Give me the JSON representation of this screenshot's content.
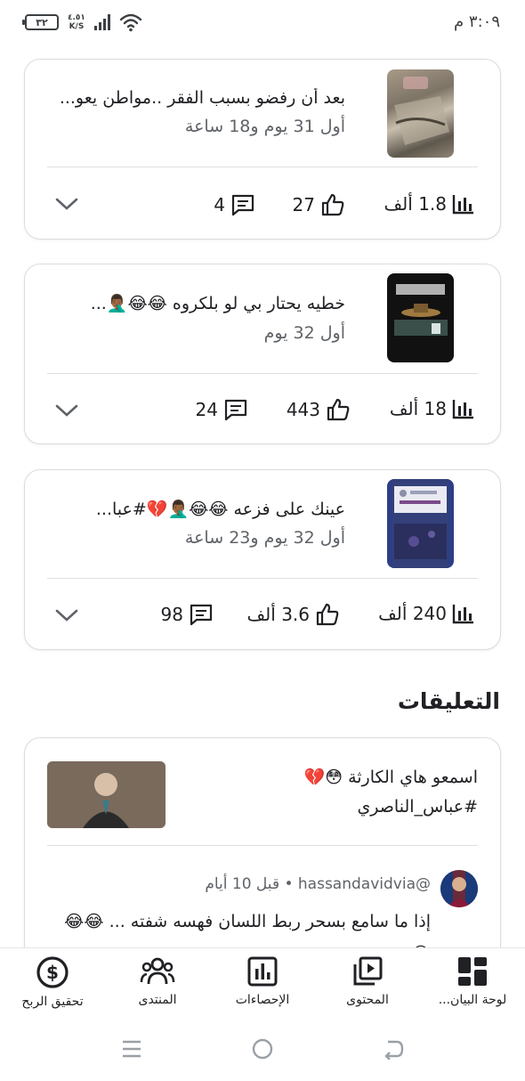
{
  "status_bar": {
    "time": "٣:٠٩ م",
    "battery": "٣٢",
    "net_speed_value": "٤.٥١",
    "net_speed_unit": "K/S"
  },
  "posts": [
    {
      "title": "بعد أن رفضو بسبب الفقر ..مواطن يعو...",
      "time": "أول 31 يوم و18 ساعة",
      "views": "1.8 ألف",
      "likes": "27",
      "comments": "4"
    },
    {
      "title": "خطيه يحتار بي لو بلكروه 😂😂🤦🏾‍♂️...",
      "time": "أول 32 يوم",
      "views": "18 ألف",
      "likes": "443",
      "comments": "24"
    },
    {
      "title": "عينك على فزعه 😂😂🤦🏾‍♂️💔#عبا...",
      "time": "أول 32 يوم و23 ساعة",
      "views": "240 ألف",
      "likes": "3.6 ألف",
      "comments": "98"
    }
  ],
  "comments_section": {
    "title": "التعليقات",
    "post_text_line1": "اسمعو هاي الكارثة 😳💔",
    "post_text_line2": "#عباس_الناصري",
    "reply": {
      "meta": "@hassandavidvia • قبل 10 أيام",
      "text": "إذا ما سامع بسحر ربط اللسان فهسه شفته ... 😂😂😂"
    }
  },
  "bottom_nav": [
    {
      "label": "لوحة البيان...",
      "icon": "dashboard-icon"
    },
    {
      "label": "المحتوى",
      "icon": "content-icon"
    },
    {
      "label": "الإحصاءات",
      "icon": "analytics-icon"
    },
    {
      "label": "المنتدى",
      "icon": "community-icon"
    },
    {
      "label": "تحقيق الربح",
      "icon": "earn-icon"
    }
  ],
  "colors": {
    "text": "#202124",
    "secondary_text": "#5f6368",
    "border": "#dcdcdc"
  }
}
